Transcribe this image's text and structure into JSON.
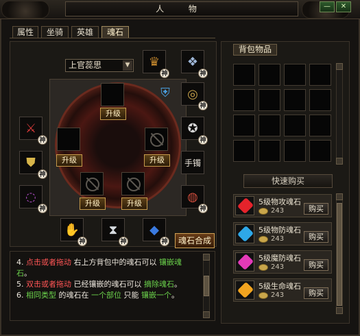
{
  "window": {
    "title": "人 物",
    "minimize_label": "—",
    "close_label": "✕"
  },
  "tabs": [
    {
      "label": "属性",
      "active": false
    },
    {
      "label": "坐骑",
      "active": false
    },
    {
      "label": "英雄",
      "active": false
    },
    {
      "label": "魂石",
      "active": true
    }
  ],
  "character_select": {
    "selected": "上官蕊思"
  },
  "soul_stone_slots": {
    "upgrade_label": "升级"
  },
  "equipment": {
    "god_badge": "神",
    "bracelet_label": "手镯"
  },
  "synthesis_button": "魂石合成",
  "info": {
    "lines": [
      [
        {
          "text": "4. ",
          "color": "white"
        },
        {
          "text": "点击或者拖动",
          "color": "red"
        },
        {
          "text": " 右上方背包中的魂石可以 ",
          "color": "white"
        },
        {
          "text": "镶嵌魂",
          "color": "green"
        }
      ],
      [
        {
          "text": "石",
          "color": "green"
        },
        {
          "text": "。",
          "color": "white"
        }
      ],
      [
        {
          "text": "5. ",
          "color": "white"
        },
        {
          "text": "双击或者拖动",
          "color": "red"
        },
        {
          "text": " 已经镶嵌的魂石可以 ",
          "color": "white"
        },
        {
          "text": "摘除魂石",
          "color": "green"
        },
        {
          "text": "。",
          "color": "white"
        }
      ],
      [
        {
          "text": "6. ",
          "color": "white"
        },
        {
          "text": "相同类型",
          "color": "green"
        },
        {
          "text": " 的魂石在 ",
          "color": "white"
        },
        {
          "text": "一个部位",
          "color": "green"
        },
        {
          "text": " 只能 ",
          "color": "white"
        },
        {
          "text": "镶嵌一个",
          "color": "green"
        },
        {
          "text": "。",
          "color": "white"
        }
      ]
    ]
  },
  "bag": {
    "title": "背包物品",
    "quick_buy_label": "快速购买",
    "items": [
      {
        "name": "5级物攻魂石",
        "price": "243",
        "buy_label": "购买",
        "gem_color": "#e5232b"
      },
      {
        "name": "5级物防魂石",
        "price": "243",
        "buy_label": "购买",
        "gem_color": "#2ea8e8"
      },
      {
        "name": "5级魔防魂石",
        "price": "243",
        "buy_label": "购买",
        "gem_color": "#e43ab8"
      },
      {
        "name": "5级生命魂石",
        "price": "243",
        "buy_label": "购买",
        "gem_color": "#f2a41f"
      }
    ]
  }
}
